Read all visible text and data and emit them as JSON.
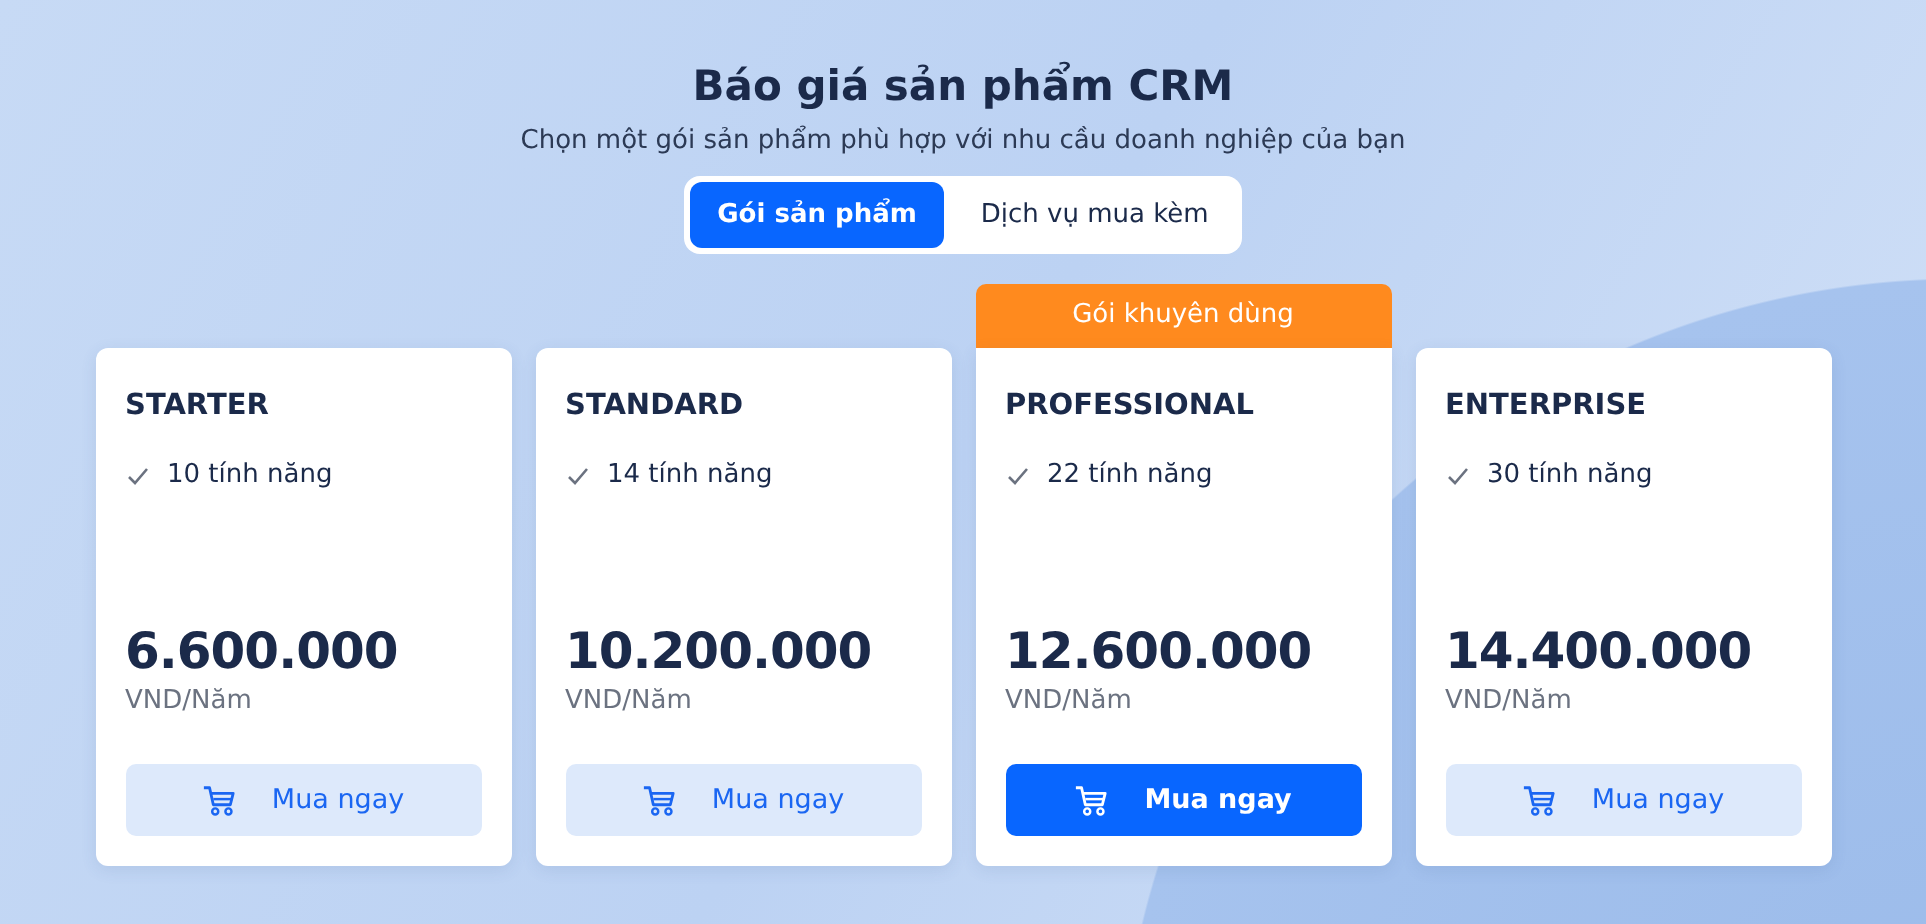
{
  "title": "Báo giá sản phẩm CRM",
  "subtitle": "Chọn một gói sản phẩm phù hợp với nhu cầu doanh nghiệp của bạn",
  "tabs": [
    {
      "label": "Gói sản phẩm",
      "selected": true
    },
    {
      "label": "Dịch vụ mua kèm",
      "selected": false
    }
  ],
  "plans": [
    {
      "name": "STARTER",
      "features": "10 tính năng",
      "price": "6.600.000",
      "unit": "VND/Năm",
      "featured": false,
      "button": "Mua ngay"
    },
    {
      "name": "STANDARD",
      "features": "14 tính năng",
      "price": "10.200.000",
      "unit": "VND/Năm",
      "featured": false,
      "button": "Mua ngay"
    },
    {
      "name": "PROFESSIONAL",
      "badge": "Gói khuyên dùng",
      "features": "22 tính năng",
      "price": "12.600.000",
      "unit": "VND/Năm",
      "featured": true,
      "button": "Mua ngay"
    },
    {
      "name": "ENTERPRISE",
      "features": "30 tính năng",
      "price": "14.400.000",
      "unit": "VND/Năm",
      "featured": false,
      "button": "Mua ngay"
    }
  ]
}
